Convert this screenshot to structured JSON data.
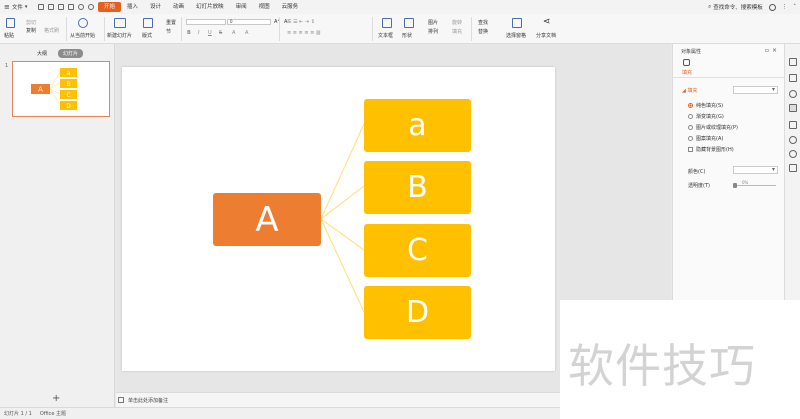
{
  "menubar": {
    "file_label": "文件",
    "tabs": [
      {
        "label": "开始",
        "active": true
      },
      {
        "label": "插入",
        "active": false
      },
      {
        "label": "设计",
        "active": false
      },
      {
        "label": "动画",
        "active": false
      },
      {
        "label": "幻灯片放映",
        "active": false
      },
      {
        "label": "审阅",
        "active": false
      },
      {
        "label": "视图",
        "active": false
      },
      {
        "label": "云服务",
        "active": false
      }
    ],
    "search_label": "查找命令、搜索模板",
    "accent_color": "#e2611f"
  },
  "ribbon": {
    "paste": "粘贴",
    "cut": "剪切",
    "copy": "复制",
    "format_painter": "格式刷",
    "from_start": "从当前开始",
    "new_slide": "新建幻灯片",
    "layout": "版式",
    "reset": "重置",
    "section": "节",
    "font_size": "0",
    "bold": "B",
    "italic": "I",
    "underline": "U",
    "strike": "S",
    "textbox": "文本框",
    "shape": "形状",
    "picture": "图片",
    "arrange": "排列",
    "rotate": "旋转",
    "fill": "填充",
    "outline": "轮廓",
    "find": "查找",
    "replace": "替换",
    "select_pane": "选择窗格",
    "share": "分享文档"
  },
  "left_panel": {
    "tab_outline": "大纲",
    "tab_slides": "幻灯片",
    "slide_number": "1",
    "add_symbol": "+"
  },
  "slide": {
    "main_label": "A",
    "children": [
      "a",
      "B",
      "C",
      "D"
    ],
    "main_color": "#ed7d31",
    "child_color": "#ffc000",
    "connector_color": "#ffe38a"
  },
  "thumbnail": {
    "main_label": "A",
    "children": [
      "a",
      "B",
      "C",
      "D"
    ]
  },
  "notes": {
    "placeholder": "单击此处添加备注"
  },
  "right_panel": {
    "title": "对象属性",
    "tab_fill": "填充",
    "section_fill": "填充",
    "options": [
      {
        "label": "纯色填充(S)",
        "type": "radio",
        "selected": true
      },
      {
        "label": "渐变填充(G)",
        "type": "radio",
        "selected": false
      },
      {
        "label": "图片或纹理填充(P)",
        "type": "radio",
        "selected": false
      },
      {
        "label": "图案填充(A)",
        "type": "radio",
        "selected": false
      },
      {
        "label": "隐藏背景图形(H)",
        "type": "checkbox",
        "selected": false
      }
    ],
    "color_label": "颜色(C)",
    "transparency_label": "透明度(T)",
    "transparency_value": "0%"
  },
  "statusbar": {
    "slide_info": "幻灯片 1 / 1",
    "theme": "Office 主题"
  },
  "watermark": "软件技巧"
}
